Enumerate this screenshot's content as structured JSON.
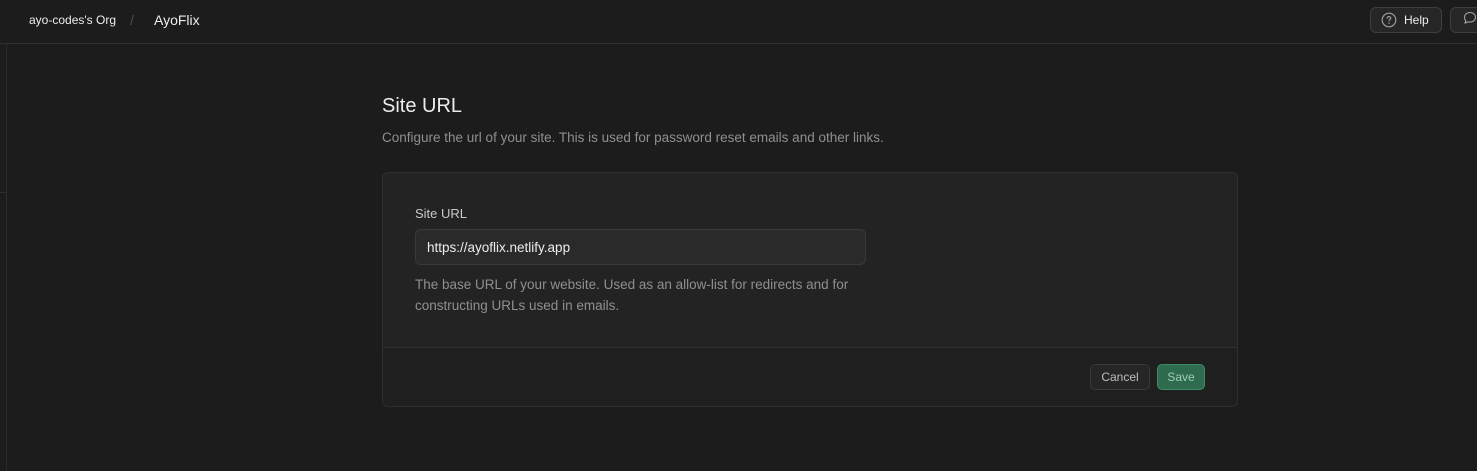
{
  "header": {
    "org_name": "ayo-codes's Org",
    "separator": "/",
    "project_name": "AyoFlix",
    "help_label": "Help",
    "help_icon": "question-circle-icon",
    "feedback_icon": "chat-bubble-icon"
  },
  "section": {
    "title": "Site URL",
    "description": "Configure the url of your site. This is used for password reset emails and other links."
  },
  "form": {
    "field_label": "Site URL",
    "site_url_value": "https://ayoflix.netlify.app",
    "help_text": "The base URL of your website. Used as an allow-list for redirects and for constructing URLs used in emails.",
    "cancel_label": "Cancel",
    "save_label": "Save"
  },
  "colors": {
    "background": "#1c1c1c",
    "panel": "#232323",
    "accent": "#3ecf8e",
    "save_button": "#2f6b4f"
  }
}
